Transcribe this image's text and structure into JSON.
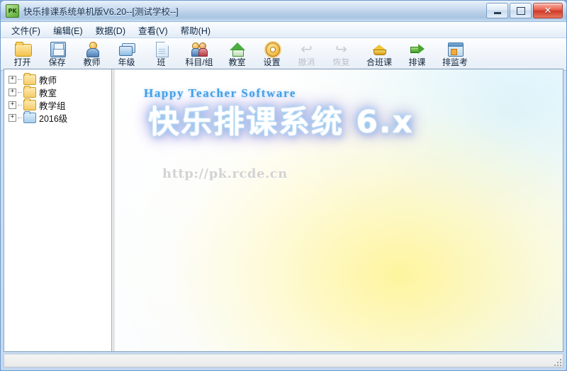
{
  "window": {
    "title": "快乐排课系统单机版V6.20--[测试学校--]",
    "app_icon": "PK",
    "controls": {
      "minimize": "minimize-icon",
      "maximize": "maximize-icon",
      "close": "close-icon"
    }
  },
  "menu": {
    "items": [
      {
        "label": "文件(F)",
        "name": "menu-file"
      },
      {
        "label": "编辑(E)",
        "name": "menu-edit"
      },
      {
        "label": "数据(D)",
        "name": "menu-data"
      },
      {
        "label": "查看(V)",
        "name": "menu-view"
      },
      {
        "label": "帮助(H)",
        "name": "menu-help"
      }
    ]
  },
  "toolbar": {
    "buttons": [
      {
        "label": "打开",
        "icon": "open-folder-icon",
        "enabled": true
      },
      {
        "label": "保存",
        "icon": "save-floppy-icon",
        "enabled": true
      },
      {
        "label": "教师",
        "icon": "teacher-person-icon",
        "enabled": true
      },
      {
        "label": "年级",
        "icon": "grade-cards-icon",
        "enabled": true
      },
      {
        "label": "班",
        "icon": "class-page-icon",
        "enabled": true
      },
      {
        "label": "科目/组",
        "icon": "subject-group-people-icon",
        "enabled": true
      },
      {
        "label": "教室",
        "icon": "classroom-house-icon",
        "enabled": true
      },
      {
        "label": "设置",
        "icon": "settings-gear-icon",
        "enabled": true
      },
      {
        "label": "撤消",
        "icon": "undo-arrow-icon",
        "enabled": false
      },
      {
        "label": "恢复",
        "icon": "redo-arrow-icon",
        "enabled": false
      },
      {
        "label": "合班课",
        "icon": "merge-class-cap-icon",
        "enabled": true
      },
      {
        "label": "排课",
        "icon": "schedule-arrow-icon",
        "enabled": true
      },
      {
        "label": "排监考",
        "icon": "exam-calendar-icon",
        "enabled": true
      }
    ]
  },
  "tree": {
    "nodes": [
      {
        "label": "教师",
        "expander": "+",
        "folder_color": "yellow"
      },
      {
        "label": "教室",
        "expander": "+",
        "folder_color": "yellow"
      },
      {
        "label": "教学组",
        "expander": "+",
        "folder_color": "yellow"
      },
      {
        "label": "2016级",
        "expander": "+",
        "folder_color": "blue"
      }
    ]
  },
  "splash": {
    "english_title": "Happy Teacher Software",
    "chinese_title": "快乐排课系统 6.x",
    "url": "http://pk.rcde.cn"
  },
  "statusbar": {
    "text": ""
  },
  "colors": {
    "titlebar_blue": "#b6cde7",
    "close_red": "#cf3a27",
    "splash_blue": "#3aa0e8",
    "splash_glow": "#7fc4ee",
    "splash_glow_purple": "#b49ae0",
    "url_gray": "#d3d3d3",
    "glow_yellow": "#fff496"
  }
}
